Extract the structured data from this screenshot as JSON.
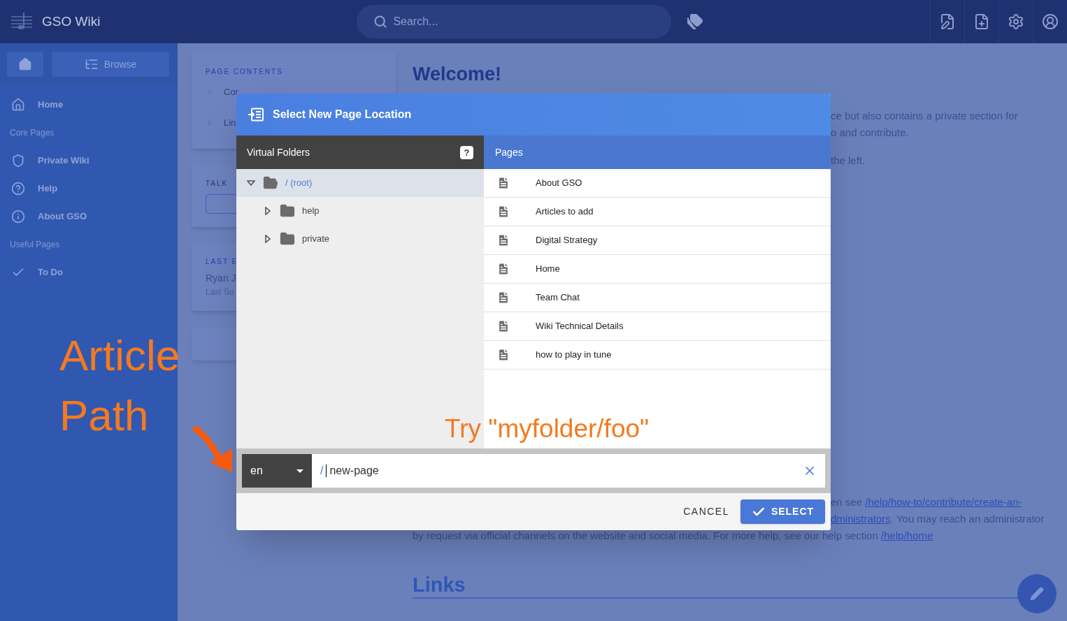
{
  "topbar": {
    "title": "GSO Wiki",
    "search": {
      "placeholder": "Search..."
    }
  },
  "sidebar": {
    "browse_button": "Browse",
    "items": [
      {
        "kind": "link",
        "label": "Home"
      },
      {
        "kind": "header",
        "label": "Core Pages"
      },
      {
        "kind": "link",
        "label": "Private Wiki"
      },
      {
        "kind": "link",
        "label": "Help"
      },
      {
        "kind": "link",
        "label": "About GSO"
      },
      {
        "kind": "header",
        "label": "Useful Pages"
      },
      {
        "kind": "link",
        "label": "To Do"
      }
    ]
  },
  "page": {
    "toc": {
      "title": "PAGE CONTENTS",
      "items": [
        "Cor",
        "Lin"
      ]
    },
    "talk": {
      "title": "TALK"
    },
    "last_edited": {
      "title": "LAST E",
      "author": "Ryan J",
      "date": "Last Su"
    },
    "heading": "Welcome!",
    "side_lines": [
      "ce but also contains a private section for",
      "o and contribute.",
      "the left."
    ],
    "bottom_lines": [
      {
        "text": "en see ",
        "link": "/help/how-to/contribute/create-an-"
      },
      {
        "link": "dministrators",
        "after": ". You may reach an administrator"
      },
      {
        "text": "by request via official channels on the website and social media. For more help, see our help section ",
        "link": "/help/home"
      }
    ],
    "links_heading": "Links"
  },
  "dialog": {
    "title": "Select New Page Location",
    "folders": {
      "title": "Virtual Folders",
      "help": "?",
      "tree": [
        {
          "label": "/ (root)",
          "expanded": true,
          "selected": true,
          "children": [
            {
              "label": "help",
              "expanded": false,
              "selected": false
            },
            {
              "label": "private",
              "expanded": false,
              "selected": false
            }
          ]
        }
      ]
    },
    "pages": {
      "title": "Pages",
      "items": [
        "About GSO",
        "Articles to add",
        "Digital Strategy",
        "Home",
        "Team Chat",
        "Wiki Technical Details",
        "how to play in tune"
      ]
    },
    "locale": {
      "value": "en"
    },
    "path": {
      "prefix": "/",
      "value": "new-page"
    },
    "buttons": {
      "cancel": "CANCEL",
      "select": "SELECT"
    }
  },
  "annotations": [
    {
      "kind": "label",
      "text": "Article Path"
    },
    {
      "kind": "hint",
      "text": "Try \"myfolder/foo\""
    },
    {
      "kind": "arrow"
    }
  ]
}
